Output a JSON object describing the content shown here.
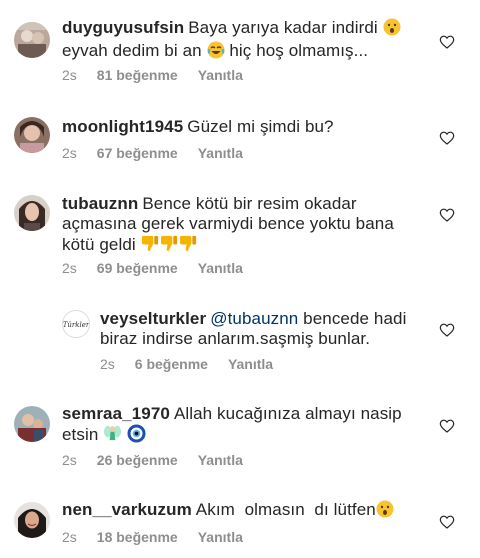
{
  "comments": [
    {
      "username": "duyguyusufsin",
      "line1": "Baya yarıya kadar indirdi",
      "line2a": "eyvah dedim bi an",
      "line2b": "hiç hoş olmamış...",
      "time": "2s",
      "likes": "81 beğenme",
      "reply": "Yanıtla",
      "emojis": [
        "surprised-face",
        "tears-of-joy-face"
      ]
    },
    {
      "username": "moonlight1945",
      "text": "Güzel mi şimdi bu?",
      "time": "2s",
      "likes": "67 beğenme",
      "reply": "Yanıtla"
    },
    {
      "username": "tubauznn",
      "line1": "Bence kötü bir resim okadar",
      "line2": "açmasına gerek varmiydi bence yoktu bana",
      "line3": "kötü geldi",
      "time": "2s",
      "likes": "69 beğenme",
      "reply": "Yanıtla",
      "emojis": [
        "thumbs-down",
        "thumbs-down",
        "thumbs-down"
      ]
    },
    {
      "username": "veyselturkler",
      "mention": "@tubauznn",
      "line1": "bencede hadi",
      "line2": "biraz indirse anlarım.saşmiş bunlar.",
      "time": "2s",
      "likes": "6 beğenme",
      "reply": "Yanıtla",
      "avatar_logo_text": "Türkler"
    },
    {
      "username": "semraa_1970",
      "line1": "Allah kucağınıza almayı nasip",
      "line2": "etsin",
      "time": "2s",
      "likes": "26 beğenme",
      "reply": "Yanıtla",
      "emojis": [
        "fairy",
        "evil-eye-nazar"
      ]
    },
    {
      "username": "nen__varkuzum",
      "text": "Akım  olmasın  dı lütfen",
      "time": "2s",
      "likes": "18 beğenme",
      "reply": "Yanıtla",
      "emojis": [
        "surprised-face"
      ]
    }
  ],
  "icons": {
    "like": "heart-outline-icon"
  },
  "colors": {
    "text": "#262626",
    "meta": "#8e8e8e",
    "mention": "#003569"
  }
}
